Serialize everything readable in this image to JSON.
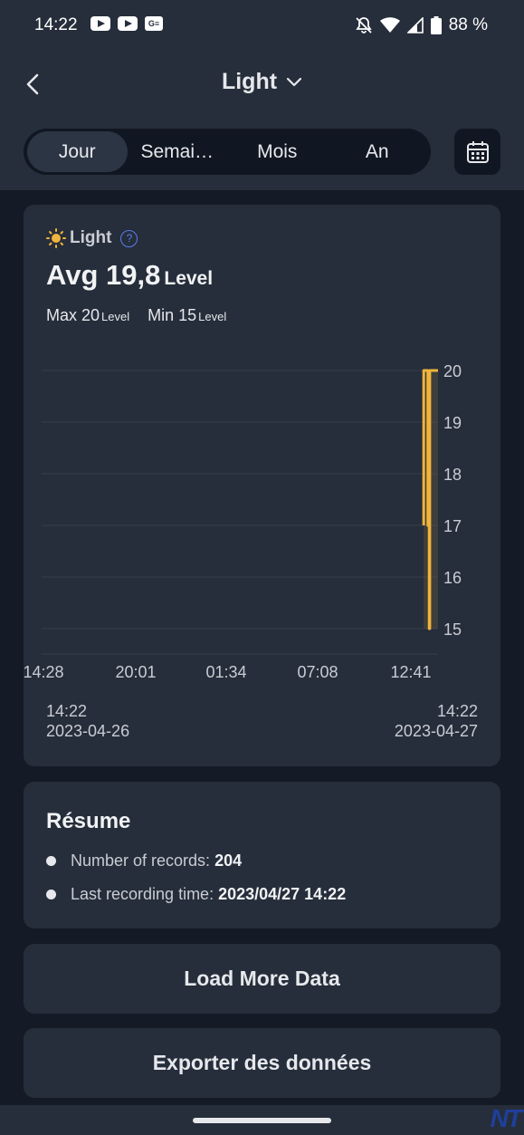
{
  "status_bar": {
    "time": "14:22",
    "battery": "88 %",
    "news_badge": "G≡"
  },
  "header": {
    "title": "Light",
    "tabs": [
      "Jour",
      "Semai…",
      "Mois",
      "An"
    ],
    "active_tab": "Jour"
  },
  "metric": {
    "name": "Light",
    "help": "?",
    "avg_label": "Avg 19,8",
    "unit": "Level",
    "max_label": "Max 20",
    "min_label": "Min 15"
  },
  "chart_data": {
    "type": "line",
    "y_ticks": [
      "20",
      "19",
      "18",
      "17",
      "16",
      "15"
    ],
    "ylim": [
      15,
      20
    ],
    "x_ticks": [
      "14:28",
      "20:01",
      "01:34",
      "07:08",
      "12:41"
    ],
    "series": [
      {
        "color": "#f0b43c",
        "points": [
          [
            "13:30",
            17
          ],
          [
            "13:30",
            20
          ],
          [
            "13:45",
            20
          ],
          [
            "13:45",
            17
          ],
          [
            "13:50",
            17
          ],
          [
            "13:50",
            15
          ],
          [
            "13:52",
            15
          ],
          [
            "13:52",
            20
          ],
          [
            "14:22",
            20
          ]
        ]
      }
    ],
    "grid": true
  },
  "range": {
    "start_time": "14:22",
    "start_date": "2023-04-26",
    "end_time": "14:22",
    "end_date": "2023-04-27"
  },
  "summary": {
    "title": "Résume",
    "records_label": "Number of records:",
    "records_value": "204",
    "last_label": "Last recording time:",
    "last_value": "2023/04/27 14:22"
  },
  "actions": {
    "load_more": "Load More Data",
    "export": "Exporter des données"
  },
  "watermark": "NT",
  "colors": {
    "accent": "#f0b43c",
    "help": "#5a7cf0"
  }
}
